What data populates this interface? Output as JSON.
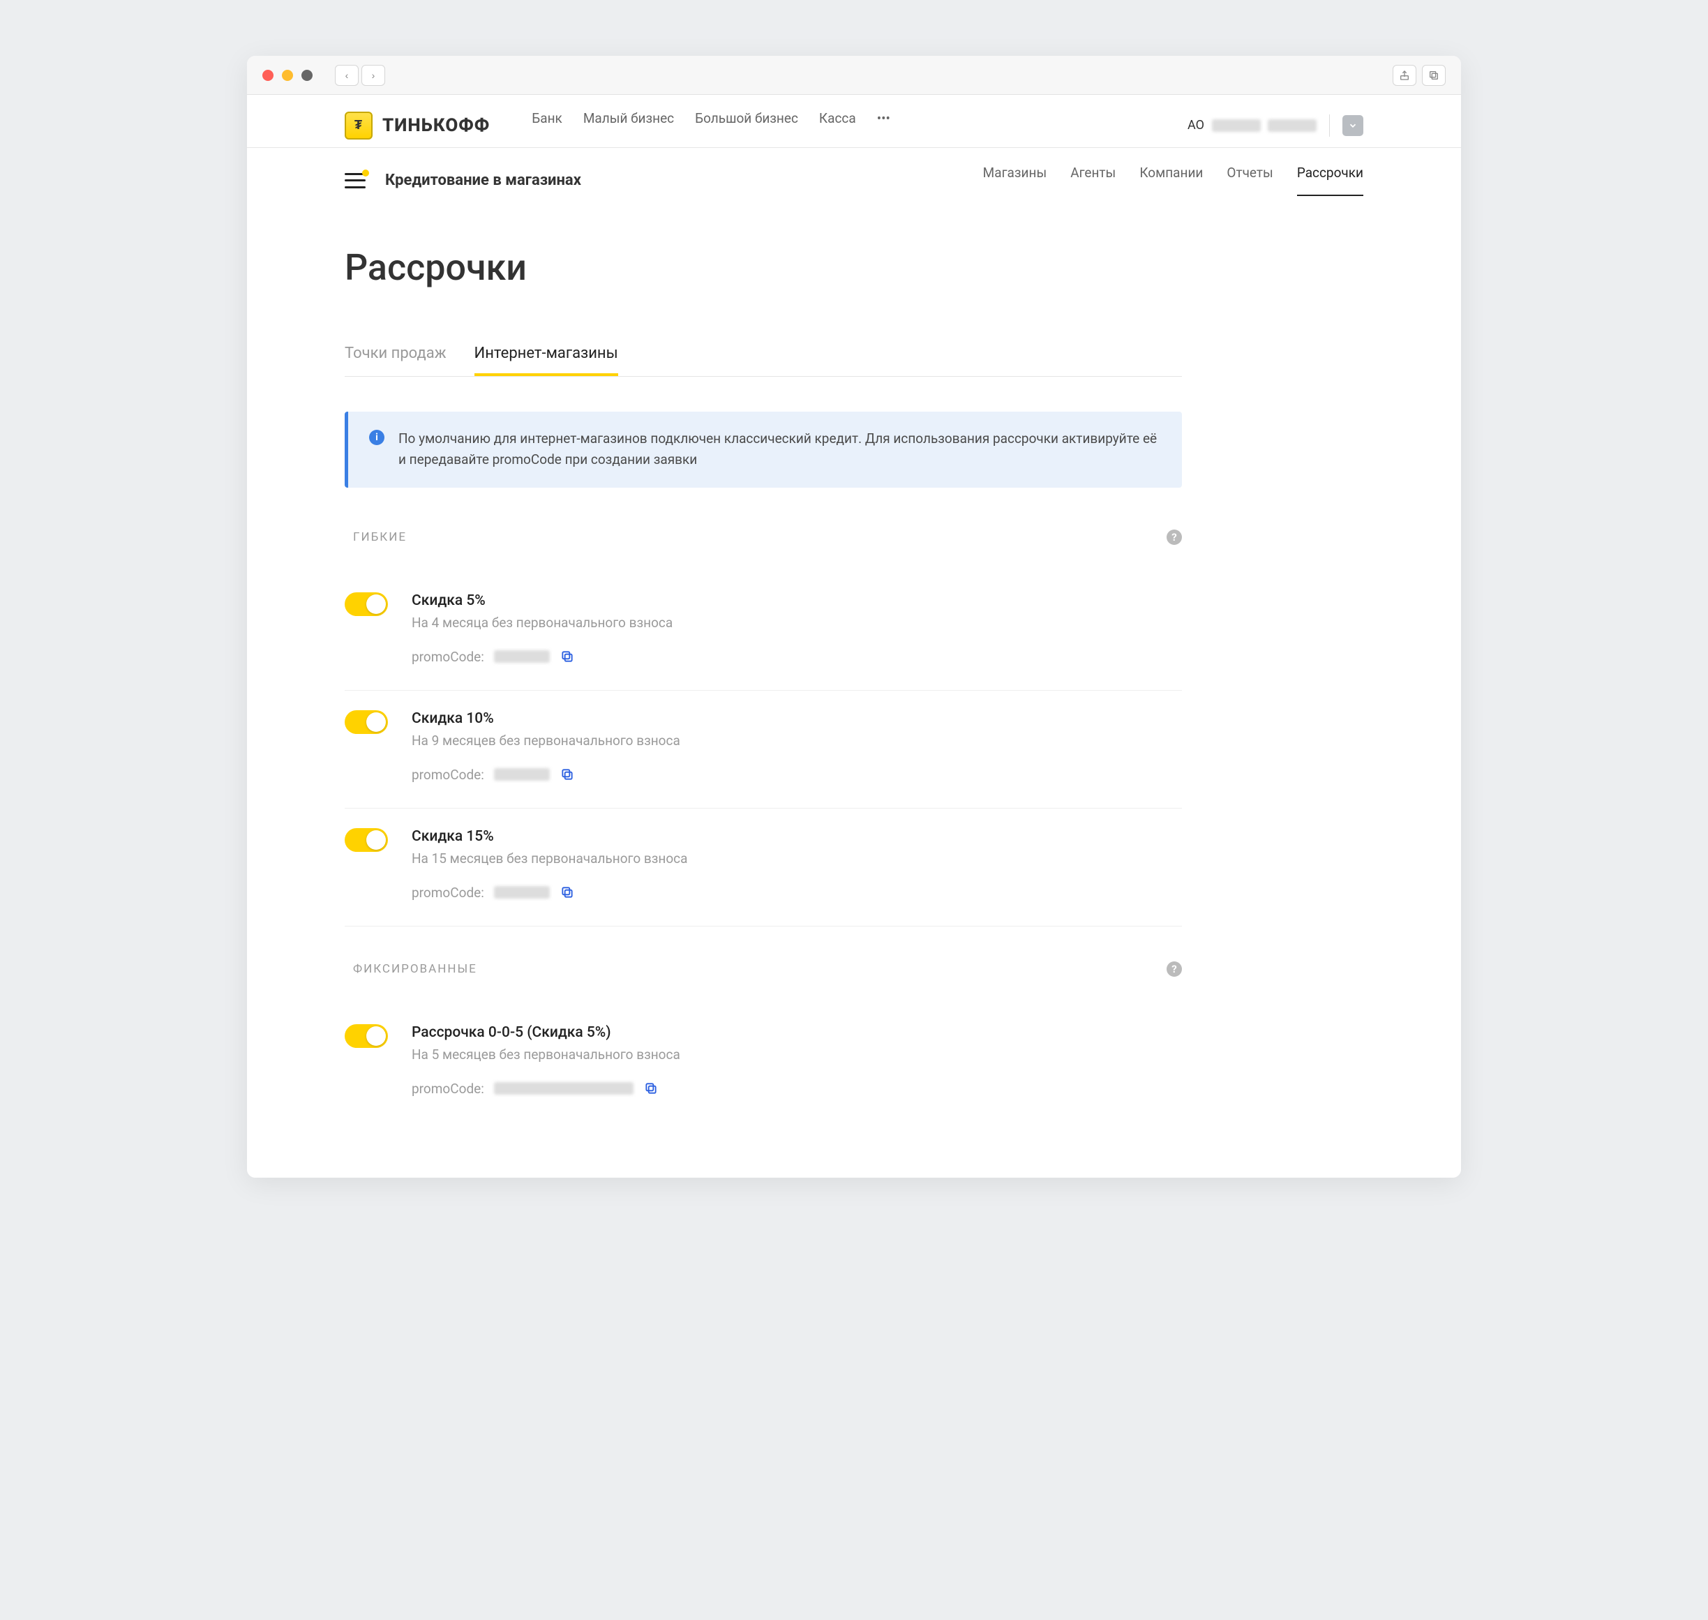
{
  "topnav": {
    "brand": "ТИНЬКОФФ",
    "links": [
      "Банк",
      "Малый бизнес",
      "Большой бизнес",
      "Касса"
    ],
    "more": "•••",
    "account_prefix": "АО"
  },
  "subnav": {
    "title": "Кредитование в магазинах",
    "links": [
      "Магазины",
      "Агенты",
      "Компании",
      "Отчеты",
      "Рассрочки"
    ],
    "active": "Рассрочки"
  },
  "page": {
    "title": "Рассрочки",
    "tabs": [
      "Точки продаж",
      "Интернет-магазины"
    ],
    "active_tab": "Интернет-магазины",
    "banner": "По умолчанию для интернет-магазинов подключен классический кредит. Для использования рассрочки активируйте её и передавайте promoCode при создании заявки"
  },
  "sections": [
    {
      "label": "ГИБКИЕ",
      "plans": [
        {
          "title": "Скидка 5%",
          "subtitle": "На 4 месяца без первоначального взноса",
          "promo_label": "promoCode:",
          "promo_wide": false
        },
        {
          "title": "Скидка 10%",
          "subtitle": "На 9 месяцев без первоначального взноса",
          "promo_label": "promoCode:",
          "promo_wide": false
        },
        {
          "title": "Скидка 15%",
          "subtitle": "На 15 месяцев без первоначального взноса",
          "promo_label": "promoCode:",
          "promo_wide": false
        }
      ]
    },
    {
      "label": "ФИКСИРОВАННЫЕ",
      "plans": [
        {
          "title": "Рассрочка 0-0-5 (Скидка 5%)",
          "subtitle": "На 5 месяцев без первоначального взноса",
          "promo_label": "promoCode:",
          "promo_wide": true
        }
      ]
    }
  ]
}
